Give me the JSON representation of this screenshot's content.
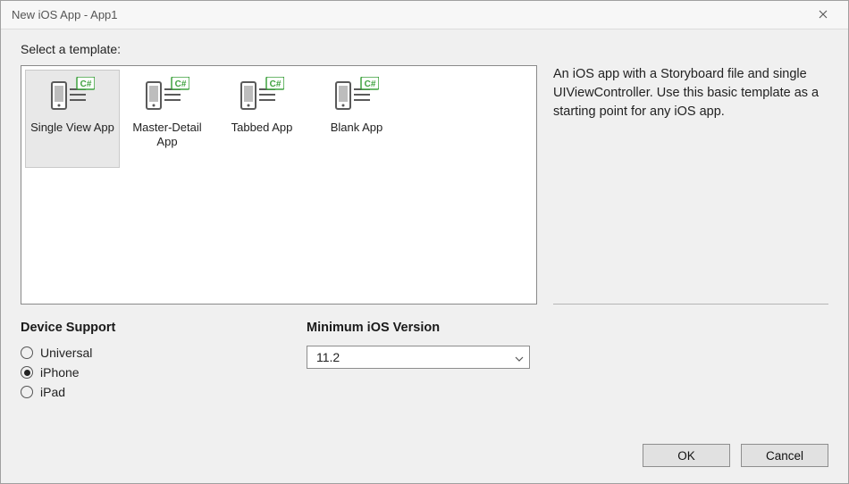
{
  "window": {
    "title": "New iOS App - App1"
  },
  "prompt": "Select a template:",
  "templates": [
    {
      "label": "Single View App",
      "selected": true
    },
    {
      "label": "Master-Detail App",
      "selected": false
    },
    {
      "label": "Tabbed App",
      "selected": false
    },
    {
      "label": "Blank App",
      "selected": false
    }
  ],
  "description": "An iOS app with a Storyboard file and single UIViewController. Use this basic template as a starting point for any iOS app.",
  "device_support": {
    "heading": "Device Support",
    "options": [
      {
        "label": "Universal",
        "selected": false
      },
      {
        "label": "iPhone",
        "selected": true
      },
      {
        "label": "iPad",
        "selected": false
      }
    ]
  },
  "min_ios": {
    "heading": "Minimum iOS Version",
    "value": "11.2"
  },
  "buttons": {
    "ok": "OK",
    "cancel": "Cancel"
  }
}
